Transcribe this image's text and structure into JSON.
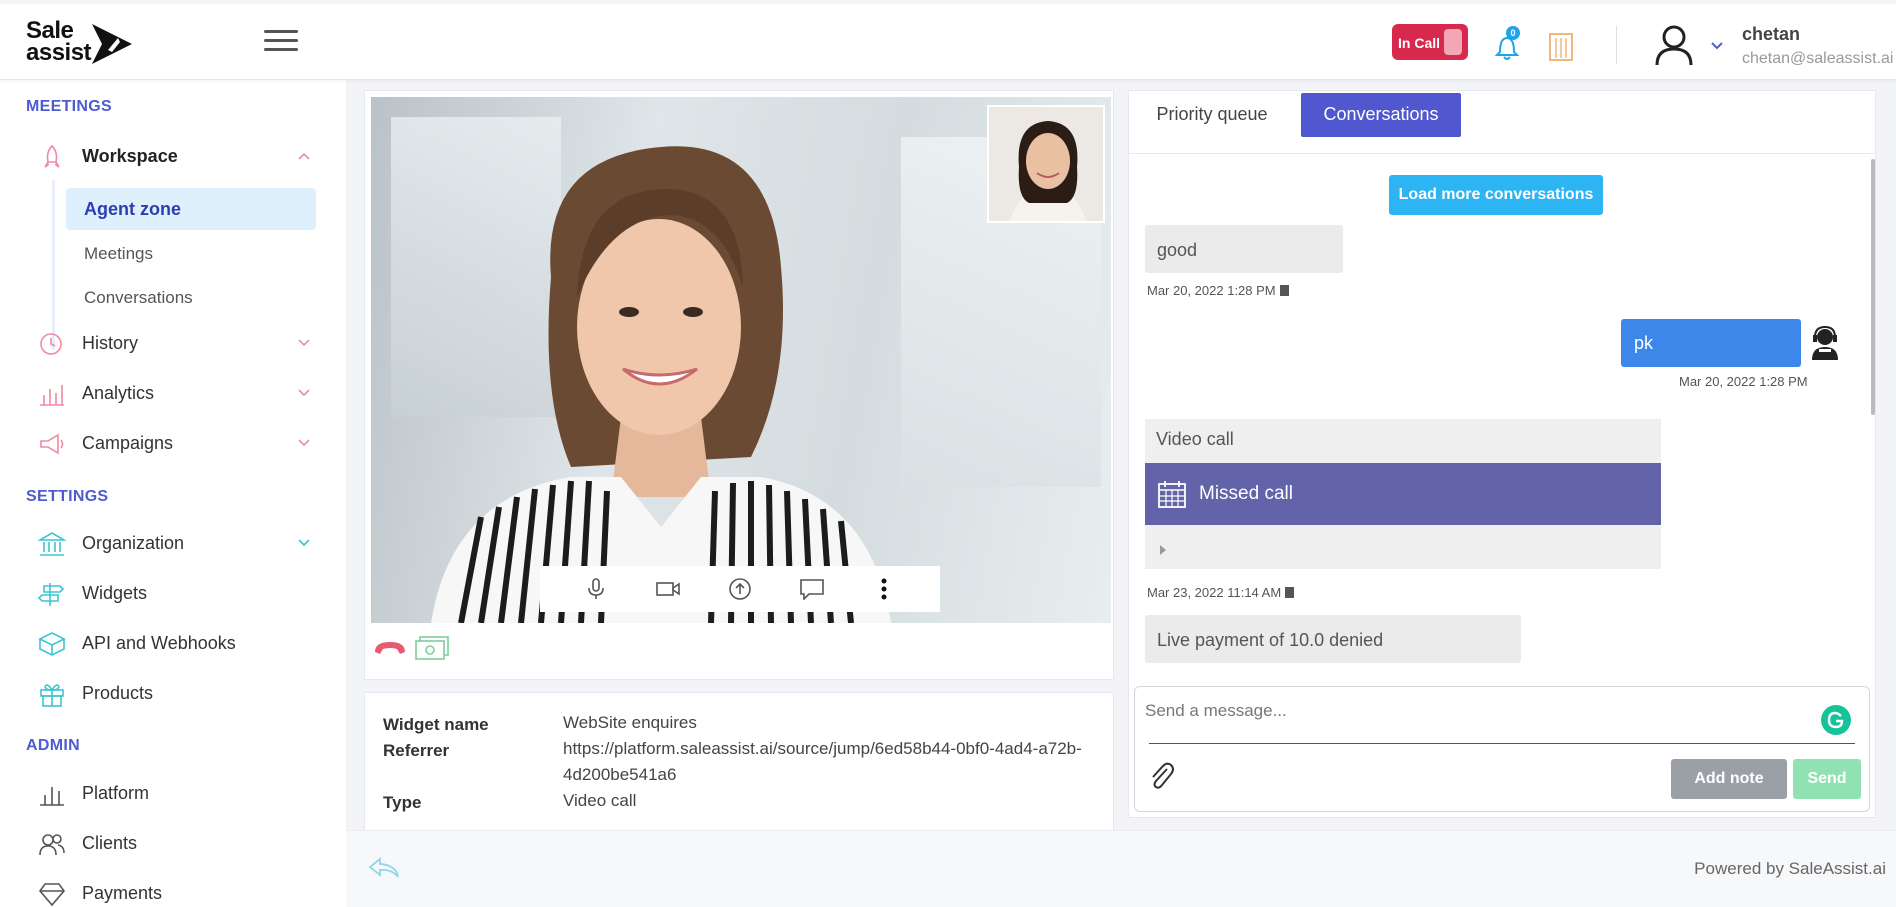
{
  "brand": {
    "line1": "Sale",
    "line2": "assist"
  },
  "header": {
    "in_call_label": "In Call",
    "notification_count": "0",
    "user_name": "chetan",
    "user_email": "chetan@saleassist.ai"
  },
  "sidebar": {
    "meetings_title": "MEETINGS",
    "settings_title": "SETTINGS",
    "admin_title": "ADMIN",
    "workspace": "Workspace",
    "sub_items": [
      "Agent zone",
      "Meetings",
      "Conversations"
    ],
    "history": "History",
    "analytics": "Analytics",
    "campaigns": "Campaigns",
    "organization": "Organization",
    "widgets": "Widgets",
    "api": "API and Webhooks",
    "products": "Products",
    "platform": "Platform",
    "clients": "Clients",
    "payments": "Payments"
  },
  "widget_info": {
    "widget_name_label": "Widget name",
    "widget_name_value": "WebSite enquires",
    "referrer_label": "Referrer",
    "referrer_value": "https://platform.saleassist.ai/source/jump/6ed58b44-0bf0-4ad4-a72b-4d200be541a6",
    "type_label": "Type",
    "type_value": "Video call"
  },
  "chat": {
    "tabs": [
      "Priority queue",
      "Conversations"
    ],
    "load_more": "Load more conversations",
    "messages": [
      {
        "text": "good",
        "time": "Mar 20, 2022 1:28 PM"
      },
      {
        "text": "pk",
        "time": "Mar 20, 2022 1:28 PM"
      },
      {
        "title": "Video call",
        "status": "Missed call",
        "time": "Mar 23, 2022 11:14 AM"
      },
      {
        "text": "Live payment of 10.0 denied"
      }
    ],
    "input_placeholder": "Send a message...",
    "add_note": "Add note",
    "send": "Send"
  },
  "footer": {
    "powered_by": "Powered by SaleAssist.ai"
  },
  "colors": {
    "accent": "#5157cf",
    "in_call": "#d7294e",
    "load_more": "#2db4f2",
    "outgoing": "#3d86ea",
    "missed_call": "#6263a9",
    "send": "#90e2b3"
  }
}
